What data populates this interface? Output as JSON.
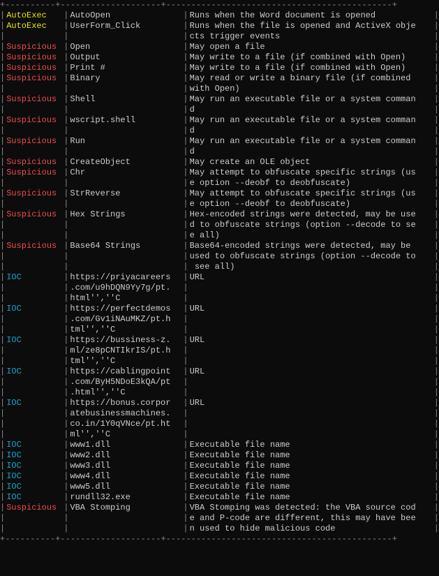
{
  "border": "+----------+--------------------+---------------------------------------------+",
  "rows": [
    {
      "type": "AutoExec",
      "typeClass": "autoexec",
      "keyword": "AutoOpen",
      "desc": "Runs when the Word document is opened"
    },
    {
      "type": "AutoExec",
      "typeClass": "autoexec",
      "keyword": "UserForm_Click",
      "desc": "Runs when the file is opened and ActiveX objects trigger events"
    },
    {
      "type": "Suspicious",
      "typeClass": "suspicious",
      "keyword": "Open",
      "desc": "May open a file"
    },
    {
      "type": "Suspicious",
      "typeClass": "suspicious",
      "keyword": "Output",
      "desc": "May write to a file (if combined with Open)"
    },
    {
      "type": "Suspicious",
      "typeClass": "suspicious",
      "keyword": "Print #",
      "desc": "May write to a file (if combined with Open)"
    },
    {
      "type": "Suspicious",
      "typeClass": "suspicious",
      "keyword": "Binary",
      "desc": "May read or write a binary file (if combined with Open)"
    },
    {
      "type": "Suspicious",
      "typeClass": "suspicious",
      "keyword": "Shell",
      "desc": "May run an executable file or a system command"
    },
    {
      "type": "Suspicious",
      "typeClass": "suspicious",
      "keyword": "wscript.shell",
      "desc": "May run an executable file or a system command"
    },
    {
      "type": "Suspicious",
      "typeClass": "suspicious",
      "keyword": "Run",
      "desc": "May run an executable file or a system command"
    },
    {
      "type": "Suspicious",
      "typeClass": "suspicious",
      "keyword": "CreateObject",
      "desc": "May create an OLE object"
    },
    {
      "type": "Suspicious",
      "typeClass": "suspicious",
      "keyword": "Chr",
      "desc": "May attempt to obfuscate specific strings (use option --deobf to deobfuscate)"
    },
    {
      "type": "Suspicious",
      "typeClass": "suspicious",
      "keyword": "StrReverse",
      "desc": "May attempt to obfuscate specific strings (use option --deobf to deobfuscate)"
    },
    {
      "type": "Suspicious",
      "typeClass": "suspicious",
      "keyword": "Hex Strings",
      "desc": "Hex-encoded strings were detected, may be used to obfuscate strings (option --decode to see all)"
    },
    {
      "type": "Suspicious",
      "typeClass": "suspicious",
      "keyword": "Base64 Strings",
      "desc": "Base64-encoded strings were detected, may be used to obfuscate strings (option --decode to see all)"
    },
    {
      "type": "IOC",
      "typeClass": "ioc",
      "keyword": "https://priyacareers.com/u9hDQN9Yy7g/pt.html'',''C",
      "desc": "URL"
    },
    {
      "type": "IOC",
      "typeClass": "ioc",
      "keyword": "https://perfectdemos.com/Gv1iNAuMKZ/pt.html'',''C",
      "desc": "URL"
    },
    {
      "type": "IOC",
      "typeClass": "ioc",
      "keyword": "https://bussiness-z.ml/ze8pCNTIkrIS/pt.html'',''C",
      "desc": "URL"
    },
    {
      "type": "IOC",
      "typeClass": "ioc",
      "keyword": "https://cablingpoint.com/ByH5NDoE3kQA/pt.html'',''C",
      "desc": "URL"
    },
    {
      "type": "IOC",
      "typeClass": "ioc",
      "keyword": "https://bonus.corporatebusinessmachines.co.in/1Y0qVNce/pt.html'',''C",
      "desc": "URL"
    },
    {
      "type": "IOC",
      "typeClass": "ioc",
      "keyword": "www1.dll",
      "desc": "Executable file name"
    },
    {
      "type": "IOC",
      "typeClass": "ioc",
      "keyword": "www2.dll",
      "desc": "Executable file name"
    },
    {
      "type": "IOC",
      "typeClass": "ioc",
      "keyword": "www3.dll",
      "desc": "Executable file name"
    },
    {
      "type": "IOC",
      "typeClass": "ioc",
      "keyword": "www4.dll",
      "desc": "Executable file name"
    },
    {
      "type": "IOC",
      "typeClass": "ioc",
      "keyword": "www5.dll",
      "desc": "Executable file name"
    },
    {
      "type": "IOC",
      "typeClass": "ioc",
      "keyword": "rundll32.exe",
      "desc": "Executable file name"
    },
    {
      "type": "Suspicious",
      "typeClass": "suspicious",
      "keyword": "VBA Stomping",
      "desc": "VBA Stomping was detected: the VBA source code and P-code are different, this may have been used to hide malicious code"
    }
  ]
}
